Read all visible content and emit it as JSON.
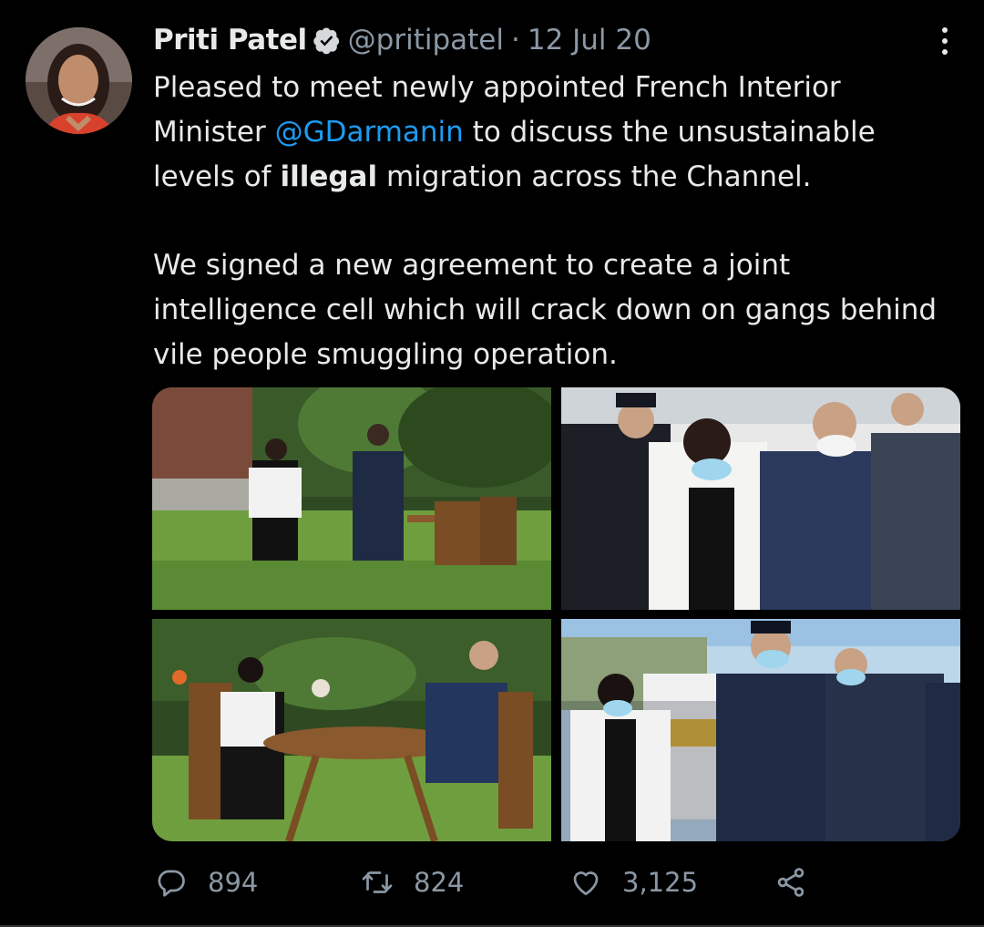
{
  "tweet": {
    "author_name": "Priti Patel",
    "handle": "@pritipatel",
    "separator": "·",
    "date": "12 Jul 20",
    "verified_icon": "verified-badge-icon",
    "more_icon": "more-vertical-icon",
    "text": {
      "p1_a": "Pleased to meet newly appointed French Interior Minister ",
      "p1_mention": "@GDarmanin",
      "p1_b": " to discuss the unsustainable levels of ",
      "p1_bold": "illegal",
      "p1_c": " migration across the Channel.",
      "p2": "We signed a new agreement to create a joint intelligence cell which will crack down on gangs behind vile people smuggling operation."
    },
    "media": [
      {
        "icon": "photo-garden-walk"
      },
      {
        "icon": "photo-officials-group"
      },
      {
        "icon": "photo-garden-table"
      },
      {
        "icon": "photo-police-officers"
      }
    ],
    "actions": {
      "replies": "894",
      "retweets": "824",
      "likes": "3,125"
    },
    "colors": {
      "background": "#000000",
      "text": "#e7e9ea",
      "secondary": "#8b98a5",
      "link": "#1d9bf0"
    }
  }
}
